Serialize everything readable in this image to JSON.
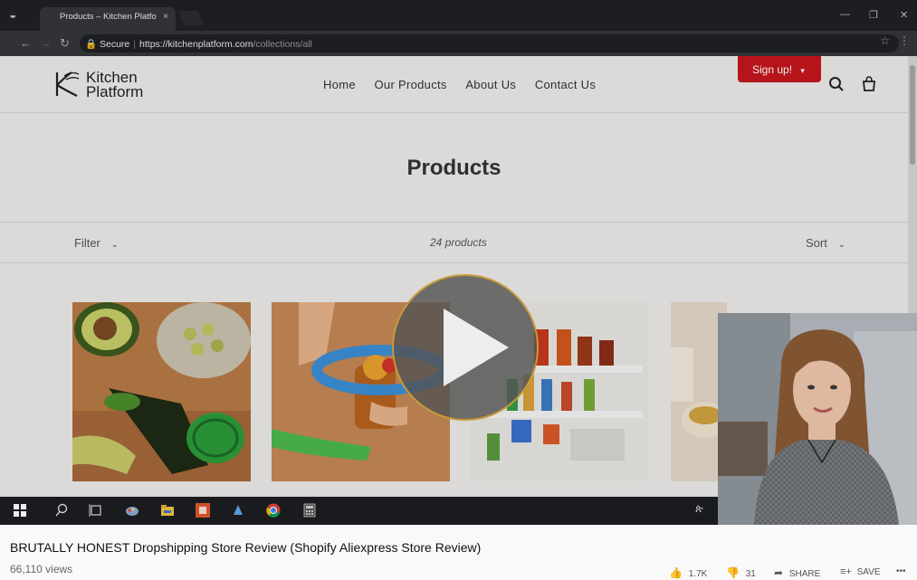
{
  "browser": {
    "tab_title": "Products – Kitchen Platfo",
    "tab_close": "×",
    "secure_label": "Secure",
    "url_host": "https://kitchenplatform.com",
    "url_path": "/collections/all"
  },
  "site": {
    "logo_line1": "Kitchen",
    "logo_line2": "Platform",
    "nav": [
      "Home",
      "Our Products",
      "About Us",
      "Contact Us"
    ],
    "signup_label": "Sign up!",
    "signup_caret": "▾",
    "page_title": "Products",
    "filter_label": "Filter",
    "product_count": "24 products",
    "sort_label": "Sort",
    "brand_red": "#c4161c"
  },
  "taskbar": {
    "icons": [
      "windows-start-icon",
      "search-icon",
      "task-view-icon",
      "paint-icon",
      "file-explorer-icon",
      "app-icon",
      "app-icon-2",
      "chrome-icon",
      "calculator-icon"
    ],
    "tray_text": "ጵ"
  },
  "video": {
    "title": "BRUTALLY HONEST Dropshipping Store Review (Shopify Aliexpress Store Review)",
    "views": "66,110 views",
    "likes": "1.7K",
    "dislikes": "31",
    "share_label": "SHARE",
    "save_label": "SAVE",
    "more_label": "•••"
  }
}
